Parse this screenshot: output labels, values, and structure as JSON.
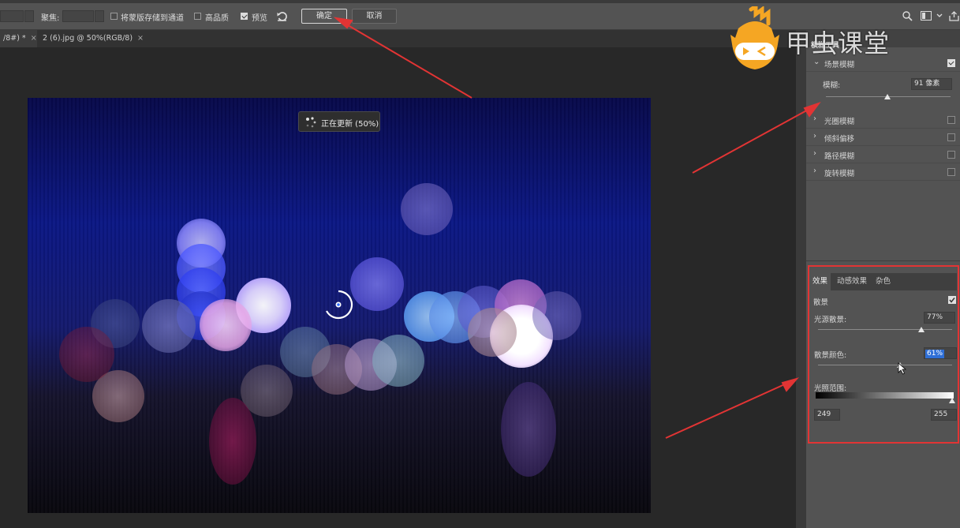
{
  "options_bar": {
    "focus_label": "聚焦:",
    "save_mask_label": "将蒙版存储到通道",
    "high_quality_label": "高品质",
    "preview_label": "预览",
    "ok_label": "确定",
    "cancel_label": "取消"
  },
  "tabs": [
    {
      "label": "/8#) *",
      "close": "×"
    },
    {
      "label": "2 (6).jpg @ 50%(RGB/8)",
      "close": "×"
    }
  ],
  "canvas": {
    "update_status": "正在更新 (50%)"
  },
  "panel": {
    "title": "模糊工具",
    "field_blur": {
      "label": "场景模糊",
      "checked": true,
      "blur_label": "模糊:",
      "blur_value": "91 像素"
    },
    "other_blurs": [
      {
        "label": "光圈模糊"
      },
      {
        "label": "倾斜偏移"
      },
      {
        "label": "路径模糊"
      },
      {
        "label": "旋转模糊"
      }
    ],
    "effects": {
      "tabs": [
        "效果",
        "动感效果",
        "杂色"
      ],
      "bokeh_label": "散景",
      "light_bokeh_label": "光源散景:",
      "light_bokeh_value": "77%",
      "light_bokeh_level": 0.77,
      "bokeh_color_label": "散景颜色:",
      "bokeh_color_value": "61%",
      "bokeh_color_level": 0.61,
      "light_range_label": "光照范围:",
      "range_min": "249",
      "range_max": "255"
    }
  },
  "watermark": {
    "text": "甲虫课堂"
  },
  "colors": {
    "annotation": "#e23434",
    "logo": "#f5a623"
  }
}
